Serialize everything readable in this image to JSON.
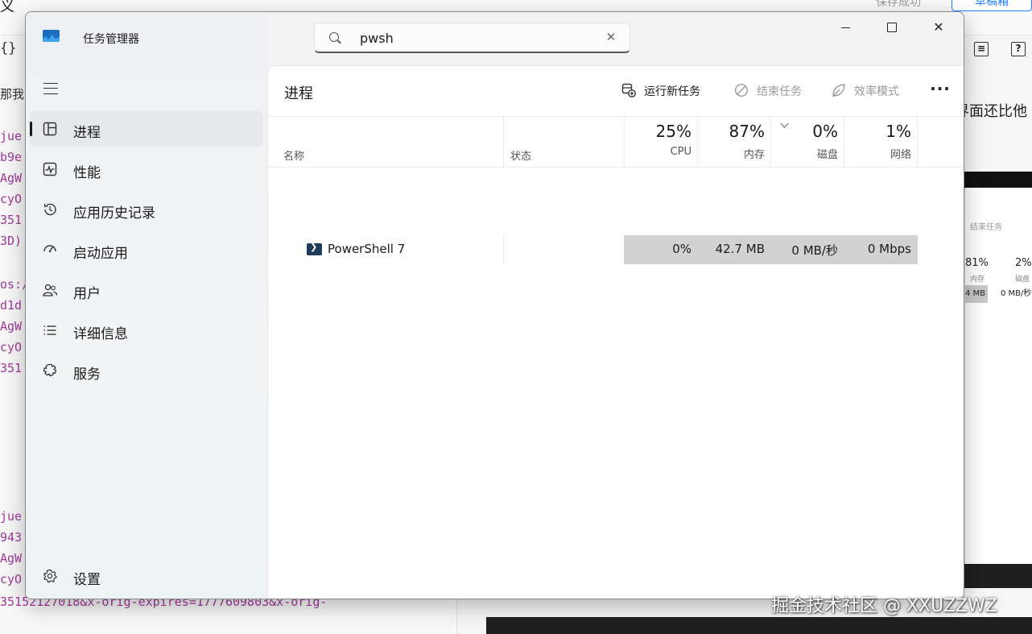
{
  "background": {
    "left_snippet": "义",
    "brace": "{}",
    "save_status": "保存成功",
    "draft_button": "草稿箱",
    "right_text": "界面还比他",
    "code_lines": [
      "那我",
      "jue",
      "b9e",
      "AgW",
      "cyO",
      "351",
      "3D)",
      "os:/",
      "d1d",
      "AgW",
      "cyO",
      "351",
      "jue",
      "943",
      "AgW",
      "cyO",
      "35152127018&x-orig-expires=1777609803&x-orig-"
    ],
    "mini_view": {
      "end_task_label": "结束任务",
      "memory_pct": "81%",
      "memory_label": "内存",
      "disk_pct": "2%",
      "disk_label": "磁盘",
      "memory_value": "4 MB",
      "disk_value": "0 MB/秒"
    }
  },
  "window": {
    "title": "任务管理器",
    "search": {
      "value": "pwsh",
      "placeholder": ""
    },
    "controls": {
      "minimize": "minimize",
      "maximize": "maximize",
      "close": "×"
    }
  },
  "sidebar": {
    "items": [
      {
        "label": "进程",
        "icon": "processes-icon",
        "active": true
      },
      {
        "label": "性能",
        "icon": "performance-icon",
        "active": false
      },
      {
        "label": "应用历史记录",
        "icon": "app-history-icon",
        "active": false
      },
      {
        "label": "启动应用",
        "icon": "startup-apps-icon",
        "active": false
      },
      {
        "label": "用户",
        "icon": "users-icon",
        "active": false
      },
      {
        "label": "详细信息",
        "icon": "details-icon",
        "active": false
      },
      {
        "label": "服务",
        "icon": "services-icon",
        "active": false
      }
    ],
    "settings_label": "设置"
  },
  "main": {
    "title": "进程",
    "commands": {
      "run_new_task": "运行新任务",
      "end_task": "结束任务",
      "efficiency_mode": "效率模式"
    },
    "columns": {
      "name": "名称",
      "status": "状态",
      "cpu": {
        "pct": "25%",
        "label": "CPU"
      },
      "memory": {
        "pct": "87%",
        "label": "内存"
      },
      "disk": {
        "pct": "0%",
        "label": "磁盘"
      },
      "network": {
        "pct": "1%",
        "label": "网络"
      }
    },
    "processes": [
      {
        "name": "PowerShell 7",
        "status": "",
        "cpu": "0%",
        "memory": "42.7 MB",
        "disk": "0 MB/秒",
        "network": "0 Mbps"
      }
    ]
  },
  "watermark": "掘金技术社区 @ XXUZZWZ",
  "colors": {
    "accent": "#1e80ff",
    "heatmap": "#d2d2d2",
    "active_nav": "#e6e8eb"
  }
}
